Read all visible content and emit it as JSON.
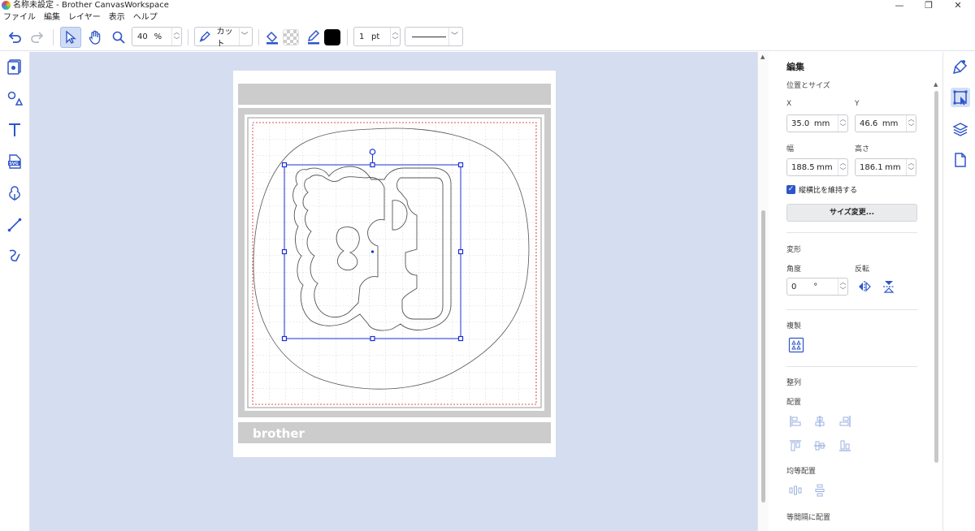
{
  "window": {
    "title": "名称未設定 - Brother CanvasWorkspace",
    "minimize": "—",
    "maximize": "❐",
    "close": "✕"
  },
  "menu": [
    "ファイル",
    "編集",
    "レイヤー",
    "表示",
    "ヘルプ"
  ],
  "toolbar": {
    "zoom_value": "40",
    "zoom_unit": "%",
    "cut_mode": "カット",
    "fill_color": "#000000",
    "line_width": "1",
    "line_unit": "pt"
  },
  "mat": {
    "brand": "brother"
  },
  "panel": {
    "title": "編集",
    "position_size": "位置とサイズ",
    "x_label": "X",
    "y_label": "Y",
    "x_value": "35.0",
    "y_value": "46.6",
    "unit": "mm",
    "width_label": "幅",
    "height_label": "高さ",
    "width_value": "188.5",
    "height_value": "186.1",
    "keep_ratio": "縦横比を維持する",
    "keep_ratio_checked": true,
    "resize_button": "サイズ変更...",
    "transform": "変形",
    "angle_label": "角度",
    "angle_value": "0",
    "angle_unit": "°",
    "flip_label": "反転",
    "duplicate": "複製",
    "align_section": "整列",
    "arrange": "配置",
    "distribute": "均等配置",
    "spacing": "等間隔に配置"
  },
  "colors": {
    "accent": "#2e55c8",
    "selection": "#1a2fd6",
    "canvas_bg": "#d5ddf0",
    "mat_gray": "#cccccc",
    "cut_area_border": "#e05050"
  }
}
